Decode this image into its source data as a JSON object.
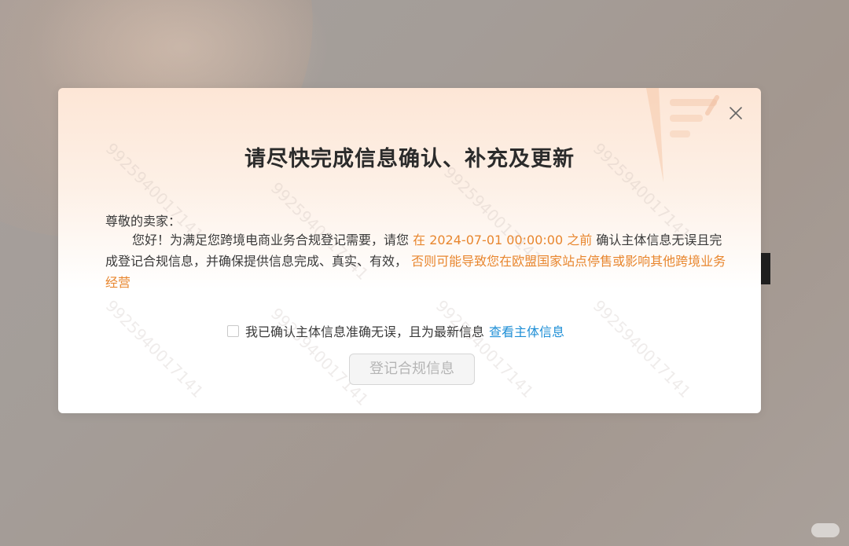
{
  "modal": {
    "title": "请尽快完成信息确认、补充及更新",
    "greeting": "尊敬的卖家：",
    "body": {
      "part1": "您好！为满足您跨境电商业务合规登记需要，请您",
      "deadline": "在 2024-07-01 00:00:00 之前",
      "part2": "确认主体信息无误且完成登记合规信息，并确保提供信息完成、真实、有效，",
      "warning": "否则可能导致您在欧盟国家站点停售或影响其他跨境业务经营"
    },
    "confirm": {
      "label": "我已确认主体信息准确无误，且为最新信息",
      "link": "查看主体信息",
      "checked": false
    },
    "register_button": "登记合规信息",
    "watermark": "9925940017141"
  },
  "colors": {
    "highlight": "#e8862e",
    "link": "#1f8fd6"
  },
  "icons": {
    "close": "close-icon"
  }
}
